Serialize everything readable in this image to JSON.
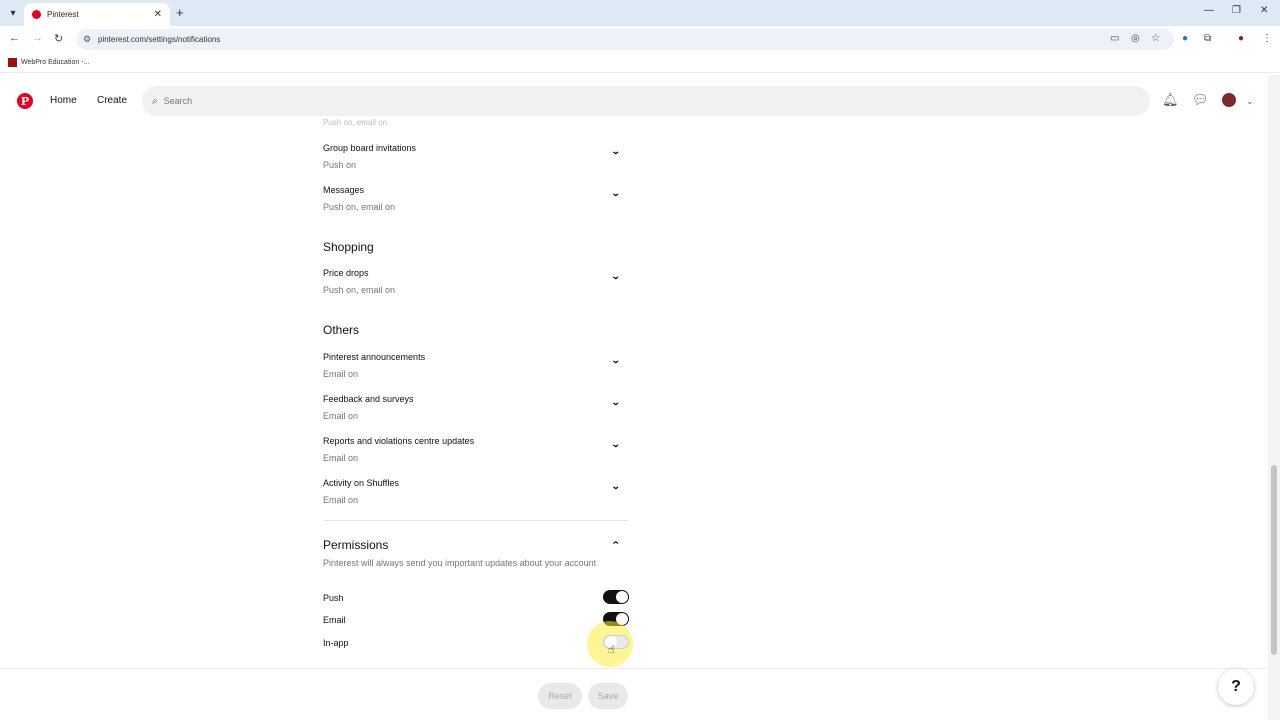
{
  "browser": {
    "tab_title": "Pinterest",
    "url": "pinterest.com/settings/notifications",
    "bookmark": "WebPro Education -..."
  },
  "header": {
    "home": "Home",
    "create": "Create",
    "search_placeholder": "Search"
  },
  "clipped_text": "Push on, email on",
  "rows": {
    "group_board": {
      "title": "Group board invitations",
      "status": "Push on"
    },
    "messages": {
      "title": "Messages",
      "status": "Push on, email on"
    },
    "price_drops": {
      "title": "Price drops",
      "status": "Push on, email on"
    },
    "announcements": {
      "title": "Pinterest announcements",
      "status": "Email on"
    },
    "feedback": {
      "title": "Feedback and surveys",
      "status": "Email on"
    },
    "reports": {
      "title": "Reports and violations centre updates",
      "status": "Email on"
    },
    "shuffles": {
      "title": "Activity on Shuffles",
      "status": "Email on"
    }
  },
  "sections": {
    "shopping": "Shopping",
    "others": "Others",
    "permissions": "Permissions"
  },
  "permissions": {
    "description": "Pinterest will always send you important updates about your account",
    "push": {
      "label": "Push",
      "on": true
    },
    "email": {
      "label": "Email",
      "on": true
    },
    "inapp": {
      "label": "In-app",
      "on": false
    }
  },
  "footer": {
    "reset": "Reset",
    "save": "Save",
    "help": "?"
  },
  "colors": {
    "brand": "#e60023",
    "toggle_on": "#111111",
    "highlight": "#ffec3c"
  }
}
